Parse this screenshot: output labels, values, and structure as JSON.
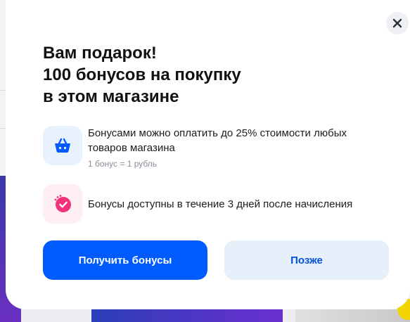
{
  "dialog": {
    "title_line1": "Вам подарок!",
    "title_line2": "100 бонусов на покупку",
    "title_line3": "в этом магазине",
    "close_icon": "close-icon"
  },
  "features": [
    {
      "icon": "basket-icon",
      "text": "Бонусами можно оплатить до 25% стоимости любых товаров магазина",
      "subtext": "1 бонус = 1 рубль"
    },
    {
      "icon": "timer-check-icon",
      "text": "Бонусы доступны в течение 3 дней после начисления"
    }
  ],
  "buttons": {
    "primary_label": "Получить бонусы",
    "secondary_label": "Позже"
  },
  "colors": {
    "accent": "#005bff",
    "secondary_bg": "#e6f0fb",
    "basket_icon_bg": "#e8f2fd",
    "timer_icon_bg": "#fdeef3",
    "timer_icon": "#f0337a"
  }
}
